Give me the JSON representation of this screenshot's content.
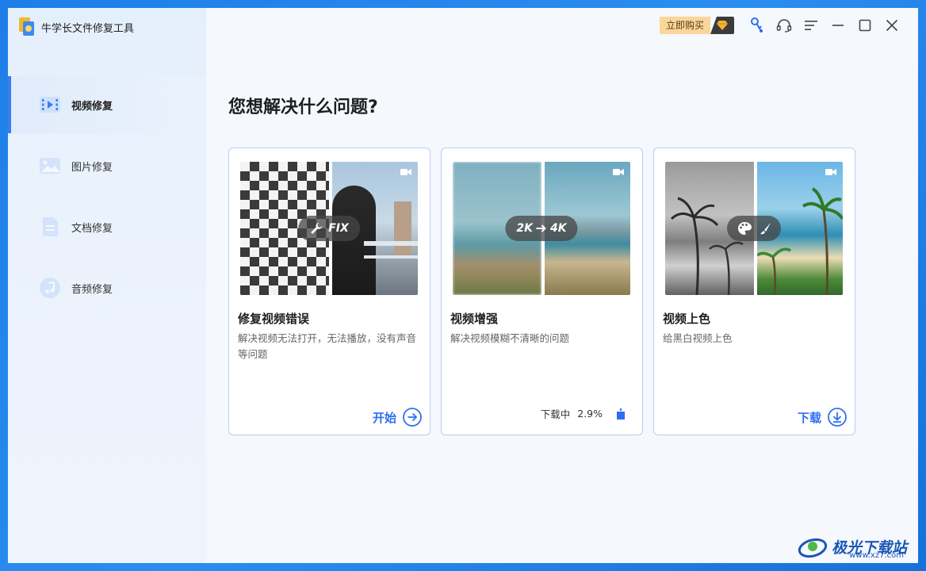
{
  "app": {
    "title": "牛学长文件修复工具"
  },
  "topbar": {
    "buy_label": "立即购买"
  },
  "sidebar": {
    "items": [
      {
        "label": "视频修复",
        "icon": "video-repair-icon",
        "active": true
      },
      {
        "label": "图片修复",
        "icon": "image-repair-icon",
        "active": false
      },
      {
        "label": "文档修复",
        "icon": "document-repair-icon",
        "active": false
      },
      {
        "label": "音频修复",
        "icon": "audio-repair-icon",
        "active": false
      }
    ]
  },
  "main": {
    "title": "您想解决什么问题?",
    "cards": [
      {
        "title": "修复视频错误",
        "desc": "解决视频无法打开，无法播放，没有声音等问题",
        "badge": "FIX",
        "action_label": "开始",
        "action_icon": "arrow-right-circle-icon"
      },
      {
        "title": "视频增强",
        "desc": "解决视频模糊不清晰的问题",
        "badge_from": "2K",
        "badge_to": "4K",
        "status_label": "下载中",
        "progress_text": "2.9%",
        "progress_value": 0.029
      },
      {
        "title": "视频上色",
        "desc": "给黑白视频上色",
        "action_label": "下载",
        "action_icon": "download-circle-icon"
      }
    ]
  },
  "watermark": {
    "text": "极光下载站",
    "sub": "www.xz7.com"
  },
  "colors": {
    "accent": "#2e6ff0",
    "card_border": "#b9cdf7",
    "buy_bg": "#f9d79a"
  }
}
